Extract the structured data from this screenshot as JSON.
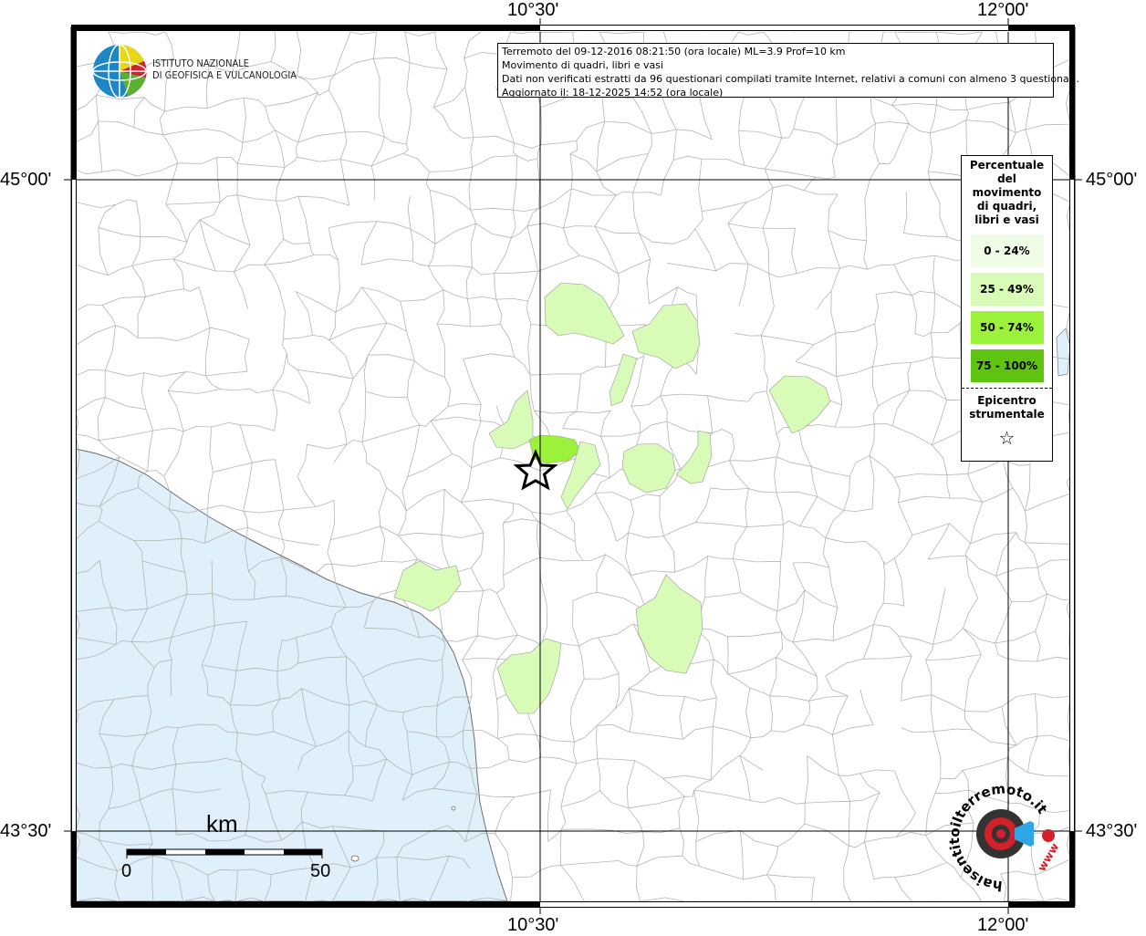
{
  "map": {
    "title_lines": [
      "Terremoto del 09-12-2016 08:21:50 (ora locale) ML=3.9 Prof=10 km",
      "Movimento di quadri, libri e vasi",
      "Dati non verificati estratti da 96 questionari compilati tramite Internet, relativi a comuni con almeno 3 questionari.",
      "Aggiornato il: 18-12-2025 14:52 (ora locale)"
    ],
    "ticks": {
      "lon_top_left": "10°30'",
      "lon_top_right": "12°00'",
      "lon_bottom_left": "10°30'",
      "lon_bottom_right": "12°00'",
      "lat_upper_left": "45°00'",
      "lat_upper_right": "45°00'",
      "lat_lower_left": "43°30'",
      "lat_lower_right": "43°30'"
    },
    "institute": {
      "line1": "ISTITUTO NAZIONALE",
      "line2": "DI GEOFISICA E VULCANOLOGIA"
    },
    "legend": {
      "title": [
        "Percentuale",
        "del",
        "movimento",
        "di quadri,",
        "libri e vasi"
      ],
      "classes": [
        {
          "label": "0 - 24%",
          "color": "#effde6"
        },
        {
          "label": "25 - 49%",
          "color": "#d9fbb8"
        },
        {
          "label": "50 - 74%",
          "color": "#9cf23a"
        },
        {
          "label": "75 - 100%",
          "color": "#5fc40f"
        }
      ],
      "epicenter_lines": [
        "Epicentro",
        "strumentale"
      ],
      "epicenter_symbol": "☆"
    },
    "scale": {
      "unit": "km",
      "start": "0",
      "end": "50"
    },
    "hst_logo": {
      "text": "haisentitoilterremoto.it",
      "www": "www"
    },
    "colors": {
      "sea": "#dff0fb",
      "border": "#000000",
      "grid": "#000000",
      "boundary": "#b4b4b4"
    }
  }
}
